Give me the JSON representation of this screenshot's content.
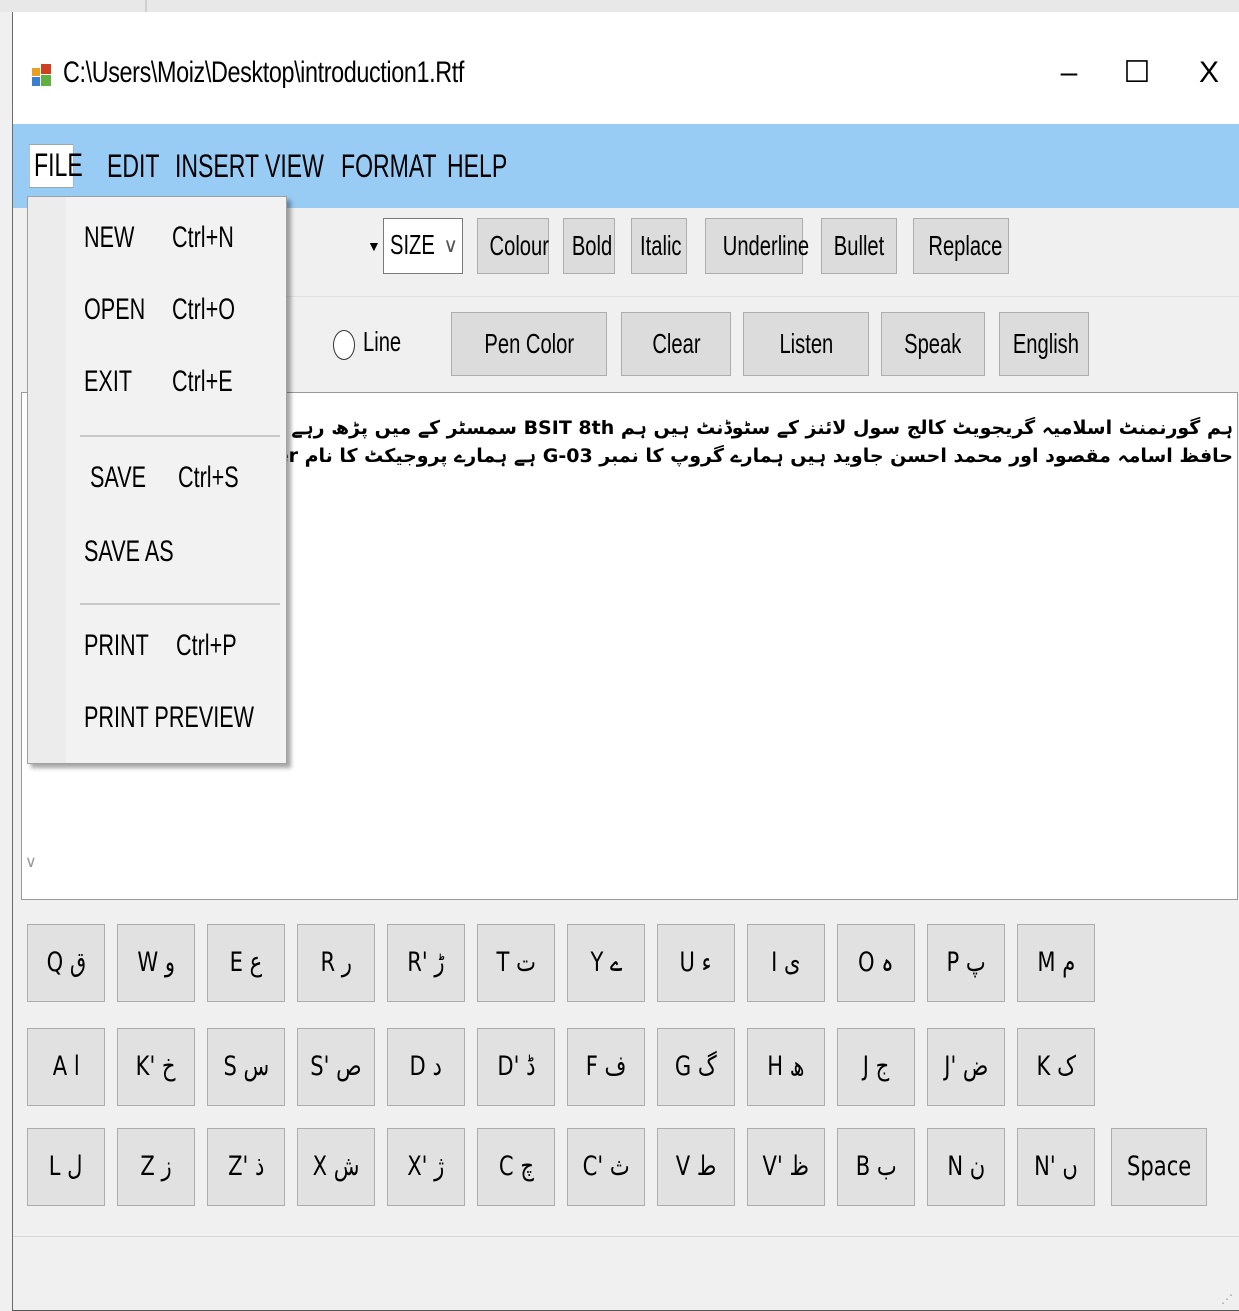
{
  "window": {
    "title": "C:\\Users\\Moiz\\Desktop\\introduction1.Rtf",
    "minimize_glyph": "–",
    "maximize_glyph": "☐",
    "close_glyph": "X"
  },
  "menubar": {
    "items": [
      "FILE",
      "EDIT",
      "INSERT",
      "VIEW",
      "FORMAT",
      "HELP"
    ],
    "bg_color": "#99ccf4"
  },
  "file_menu": {
    "items": [
      {
        "label": "NEW",
        "shortcut": "Ctrl+N"
      },
      {
        "label": "OPEN",
        "shortcut": "Ctrl+O"
      },
      {
        "label": "EXIT",
        "shortcut": "Ctrl+E"
      },
      {
        "label": "SAVE",
        "shortcut": "Ctrl+S"
      },
      {
        "label": "SAVE AS",
        "shortcut": ""
      },
      {
        "label": "PRINT",
        "shortcut": "Ctrl+P"
      },
      {
        "label": "PRINT PREVIEW",
        "shortcut": ""
      }
    ]
  },
  "toolbar": {
    "size_select": "SIZE",
    "buttons": [
      "Colour",
      "Bold",
      "Italic",
      "Underline",
      "Bullet",
      "Replace"
    ]
  },
  "drawbar": {
    "radio_label": "Line",
    "buttons": [
      "Pen Color",
      "Clear",
      "Listen",
      "Speak",
      "English"
    ]
  },
  "editor": {
    "line1": "ہم گورنمنٹ اسلامیہ گریجویٹ کالج سول لائنز کے سٹوڈنٹ ہیں ہم BSIT 8th سمسٹر کے میں پڑھ رہے ہیں میرا نام معیز اجمل ہے",
    "line2": "حافظ اسامہ مقصود اور محمد احسن جاوید ہیں ہمارے گروپ کا نمبر G-03 ہے ہمارے پروجیکٹ کا نام Urdu Master ہے"
  },
  "keyboard": {
    "row1": [
      "Q ق",
      "W و",
      "E ع",
      "R ر",
      "R' ڑ",
      "T ت",
      "Y ے",
      "U ء",
      "I ی",
      "O ہ",
      "P پ",
      "M م"
    ],
    "row2": [
      "A ا",
      "K' خ",
      "S س",
      "S' ص",
      "D د",
      "D' ڈ",
      "F ف",
      "G گ",
      "H ھ",
      "J ج",
      "J' ض",
      "K ک"
    ],
    "row3": [
      "L ل",
      "Z ز",
      "Z' ذ",
      "X ش",
      "X' ژ",
      "C چ",
      "C' ث",
      "V ط",
      "V' ظ",
      "B ب",
      "N ن",
      "N' ں",
      "Space"
    ]
  }
}
